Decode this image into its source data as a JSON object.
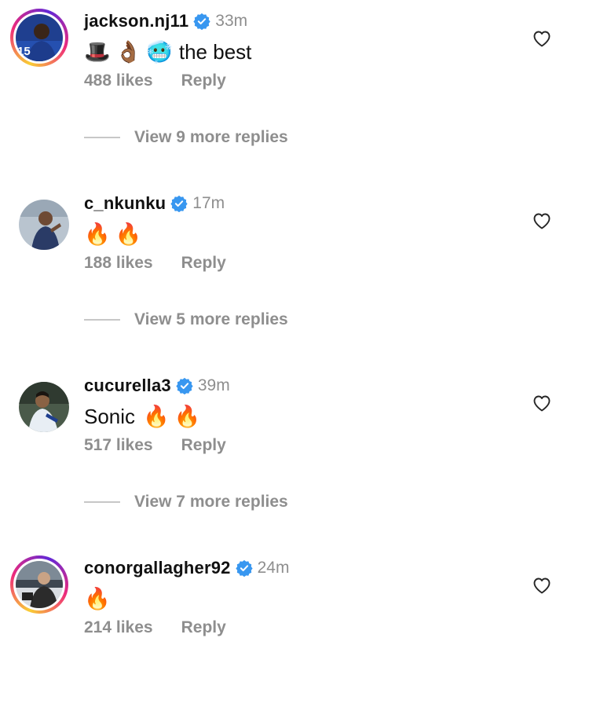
{
  "comments": [
    {
      "username": "jackson.nj11",
      "time": "33m",
      "emojis": [
        "🎩",
        "👌🏾",
        "🥶"
      ],
      "text": "the best",
      "likes": "488 likes",
      "reply": "Reply",
      "view_replies": "View 9 more replies",
      "avatar_ring": "story"
    },
    {
      "username": "c_nkunku",
      "time": "17m",
      "emojis": [
        "🔥",
        "🔥"
      ],
      "text": "",
      "likes": "188 likes",
      "reply": "Reply",
      "view_replies": "View 5 more replies",
      "avatar_ring": "none"
    },
    {
      "username": "cucurella3",
      "time": "39m",
      "emojis": [],
      "text": "Sonic",
      "trailing_emojis": [
        "🔥",
        "🔥"
      ],
      "likes": "517 likes",
      "reply": "Reply",
      "view_replies": "View 7 more replies",
      "avatar_ring": "none"
    },
    {
      "username": "conorgallagher92",
      "time": "24m",
      "emojis": [
        "🔥"
      ],
      "text": "",
      "likes": "214 likes",
      "reply": "Reply",
      "avatar_ring": "story"
    }
  ],
  "colors": {
    "verified": "#3897f0",
    "muted": "#8e8e8e",
    "text": "#111111"
  },
  "icons": {
    "verified": "verified-badge-icon",
    "like": "heart-outline-icon"
  }
}
